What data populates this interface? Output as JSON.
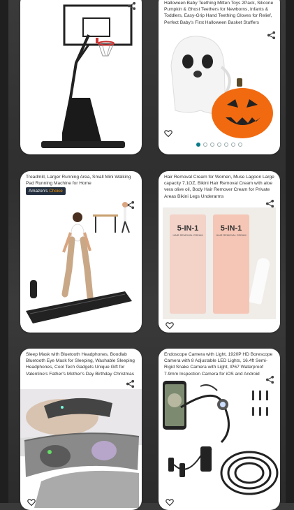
{
  "products": [
    {
      "id_label": "card-basketball-hoop",
      "title": "",
      "icons": {
        "share": "share-icon"
      }
    },
    {
      "id_label": "card-halloween-teether",
      "title": "Halloween Baby Teething Mitten Toys 2Pack, Silicone Pumpkin & Ghost Teethers for Newborns, Infants & Toddlers, Easy-Grip Hand Teething Gloves for Relief, Perfect Baby's First Halloween Basket Stuffers",
      "icons": {
        "share": "share-icon",
        "favorite": "heart-icon"
      },
      "carousel_total": 7,
      "carousel_active": 0
    },
    {
      "id_label": "card-treadmill",
      "title": "Treadmill, Larger Running Area, Small Mini Walking Pad Running Machine for Home",
      "badge": {
        "prefix": "Amazon's",
        "suffix": "Choice"
      },
      "icons": {
        "share": "share-icon"
      }
    },
    {
      "id_label": "card-hair-removal",
      "title": "Hair Removal Cream for Women, Muse Lagoon Large capacity 7.1OZ, Bikini Hair Removal Cream with aloe vera olive oil, Body Hair Remover Cream for Private Areas Bikini Legs Underarms",
      "product_text": {
        "brand": "5-IN-1",
        "sub": "HAIR REMOVAL CREAM"
      },
      "icons": {
        "share": "share-icon",
        "favorite": "heart-icon"
      }
    },
    {
      "id_label": "card-sleep-mask",
      "title": "Sleep Mask with Bluetooth Headphones, Boodlab Bluetooth Eye Mask for Sleeping, Washable Sleeping Headphones, Cool Tech Gadgets Unique Gift for Valentine's Father's Mother's Day Birthday Christmas",
      "icons": {
        "share": "share-icon",
        "favorite": "heart-icon"
      }
    },
    {
      "id_label": "card-endoscope",
      "title": "Endoscope Camera with Light, 1920P HD Borescope Camera with 8 Adjustable LED Lights, 16.4ft Semi-Rigid Snake Camera with Light, IP67 Waterproof 7.9mm Inspection Camera for iOS and Android",
      "icons": {
        "share": "share-icon",
        "favorite": "heart-icon"
      }
    }
  ]
}
